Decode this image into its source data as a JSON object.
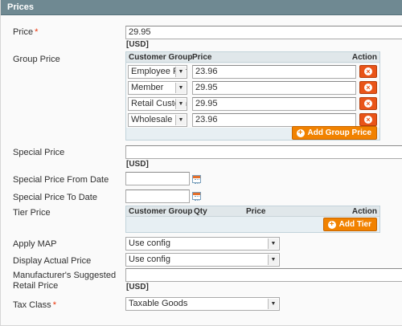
{
  "panel": {
    "title": "Prices"
  },
  "price": {
    "label": "Price",
    "value": "29.95",
    "currency": "[USD]"
  },
  "group_price": {
    "label": "Group Price",
    "columns": {
      "customer_group": "Customer Group",
      "price": "Price",
      "action": "Action"
    },
    "rows": [
      {
        "group": "Employee Purch",
        "price": "23.96"
      },
      {
        "group": "Member",
        "price": "29.95"
      },
      {
        "group": "Retail Customer",
        "price": "29.95"
      },
      {
        "group": "Wholesale",
        "price": "23.96"
      }
    ],
    "add_label": "Add Group Price"
  },
  "special_price": {
    "label": "Special Price",
    "value": "",
    "currency": "[USD]"
  },
  "special_from": {
    "label": "Special Price From Date",
    "value": ""
  },
  "special_to": {
    "label": "Special Price To Date",
    "value": ""
  },
  "tier_price": {
    "label": "Tier Price",
    "columns": {
      "customer_group": "Customer Group",
      "qty": "Qty",
      "price": "Price",
      "action": "Action"
    },
    "add_label": "Add Tier"
  },
  "apply_map": {
    "label": "Apply MAP",
    "value": "Use config"
  },
  "display_actual": {
    "label": "Display Actual Price",
    "value": "Use config"
  },
  "msrp": {
    "label": "Manufacturer's Suggested Retail Price",
    "value": "",
    "currency": "[USD]"
  },
  "tax_class": {
    "label": "Tax Class",
    "value": "Taxable Goods"
  },
  "required_marker": "*"
}
